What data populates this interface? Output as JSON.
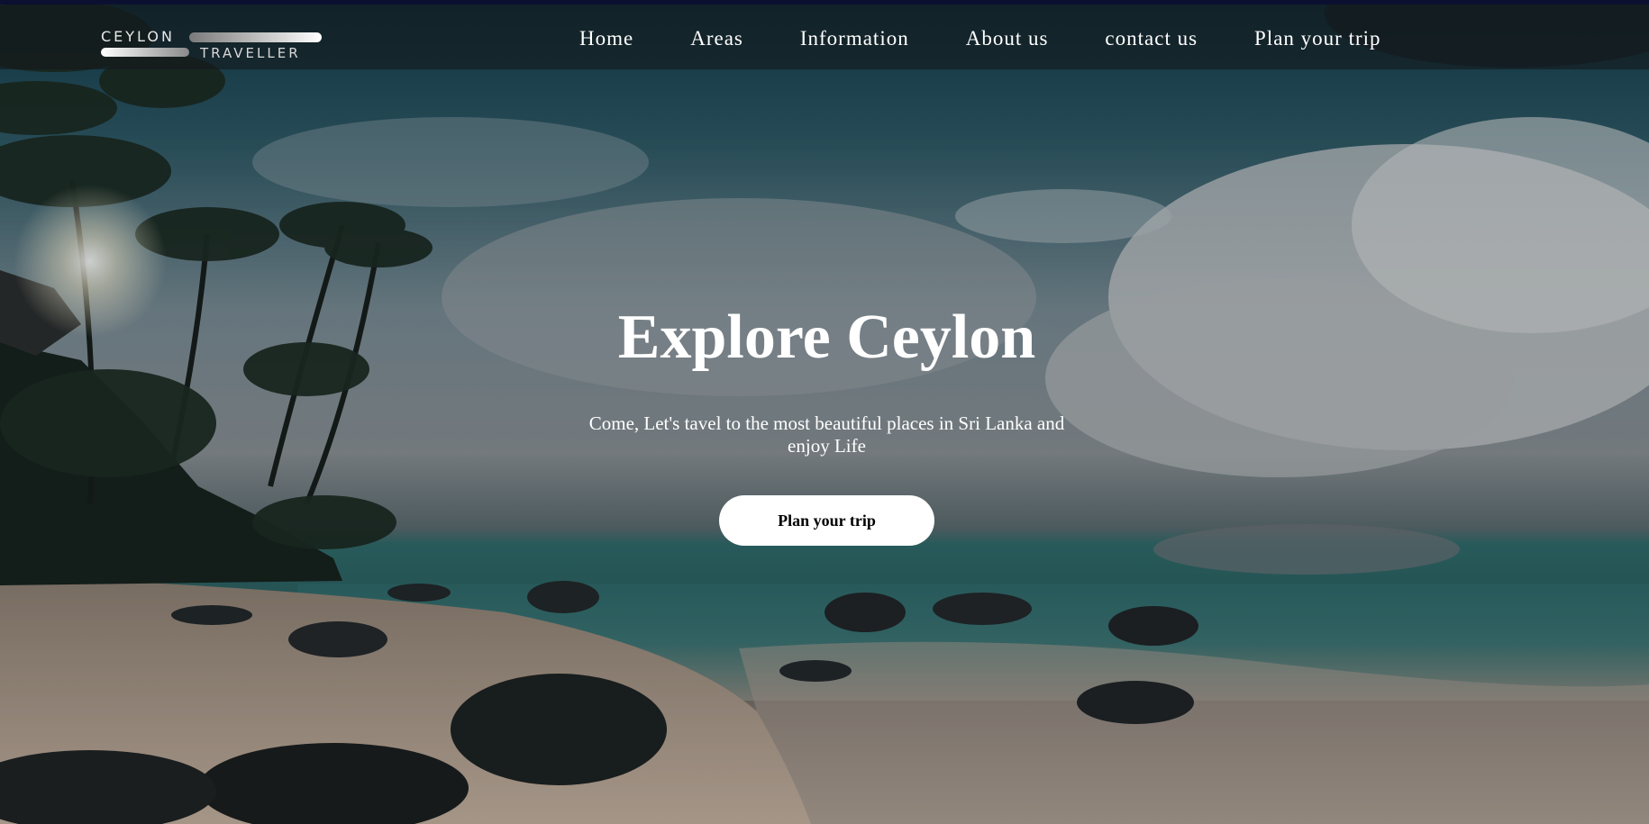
{
  "logo": {
    "word1": "CEYLON",
    "word2": "TRAVELLER"
  },
  "nav": {
    "items": [
      {
        "label": "Home"
      },
      {
        "label": "Areas"
      },
      {
        "label": "Information"
      },
      {
        "label": "About us"
      },
      {
        "label": "contact us"
      },
      {
        "label": "Plan your trip"
      }
    ]
  },
  "hero": {
    "title": "Explore Ceylon",
    "subtitle": "Come, Let's tavel to the most beautiful places in Sri Lanka and enjoy Life",
    "cta_label": "Plan your trip"
  },
  "colors": {
    "navbar_bg": "#14181c",
    "topline": "#0b1030",
    "button_bg": "#ffffff",
    "text": "#ffffff"
  }
}
